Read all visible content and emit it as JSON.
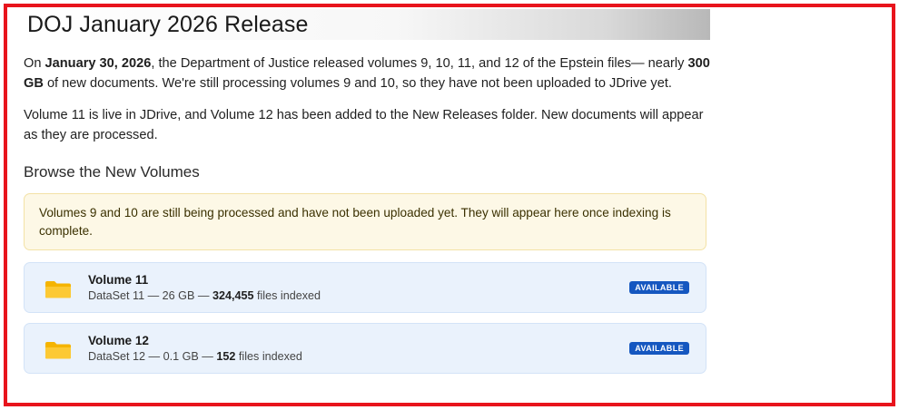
{
  "page_title": "DOJ January 2026 Release",
  "intro": {
    "t1": "On ",
    "date": "January 30, 2026",
    "t2": ", the Department of Justice released volumes 9, 10, 11, and 12 of the Epstein files— nearly ",
    "size": "300 GB",
    "t3": " of new documents. We're still processing volumes 9 and 10, so they have not been uploaded to JDrive yet."
  },
  "status_paragraph": "Volume 11 is live in JDrive, and Volume 12 has been added to the New Releases folder. New documents will appear as they are processed.",
  "section_heading": "Browse the New Volumes",
  "notice": "Volumes 9 and 10 are still being processed and have not been uploaded yet. They will appear here once indexing is complete.",
  "volumes": [
    {
      "title": "Volume 11",
      "meta_prefix": "DataSet 11 — 26 GB — ",
      "files": "324,455",
      "meta_suffix": " files indexed",
      "badge": "AVAILABLE"
    },
    {
      "title": "Volume 12",
      "meta_prefix": "DataSet 12 — 0.1 GB — ",
      "files": "152",
      "meta_suffix": " files indexed",
      "badge": "AVAILABLE"
    }
  ],
  "colors": {
    "frame_border": "#e8141c",
    "notice_bg": "#fdf8e6",
    "card_bg": "#eaf2fc",
    "badge_bg": "#1557c0",
    "folder": "#f5b400"
  },
  "icons": {
    "volume_icon": "folder-icon"
  }
}
